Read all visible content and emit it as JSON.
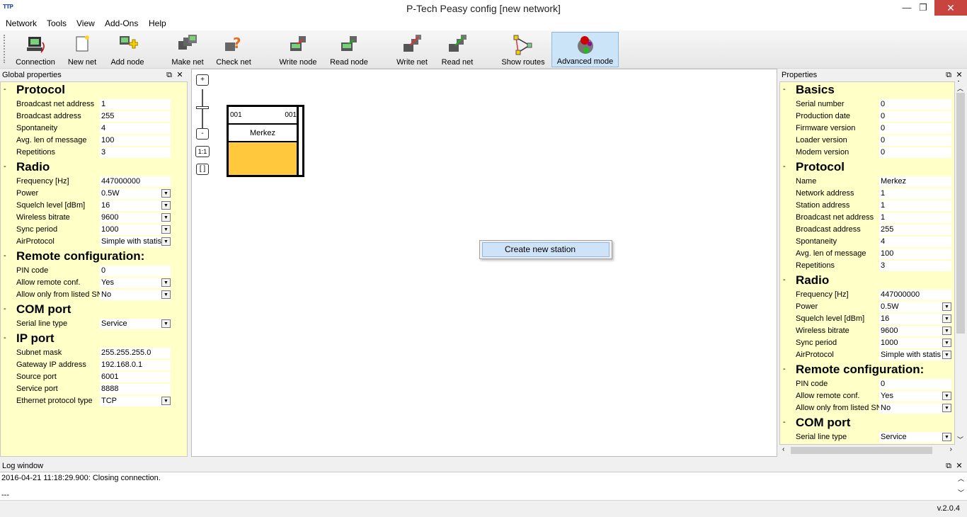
{
  "window": {
    "title": "P-Tech Peasy config [new network]",
    "logo": "TTP",
    "minimize": "—",
    "restore": "❐",
    "close": "✕"
  },
  "menu": [
    "Network",
    "Tools",
    "View",
    "Add-Ons",
    "Help"
  ],
  "toolbar": [
    {
      "label": "Connection",
      "icon": "connection-icon"
    },
    {
      "label": "New net",
      "icon": "new-net-icon"
    },
    {
      "label": "Add node",
      "icon": "add-node-icon"
    },
    {
      "label": "Make net",
      "icon": "make-net-icon"
    },
    {
      "label": "Check net",
      "icon": "check-net-icon"
    },
    {
      "label": "Write node",
      "icon": "write-node-icon"
    },
    {
      "label": "Read node",
      "icon": "read-node-icon"
    },
    {
      "label": "Write net",
      "icon": "write-net-icon"
    },
    {
      "label": "Read net",
      "icon": "read-net-icon"
    },
    {
      "label": "Show routes",
      "icon": "show-routes-icon"
    },
    {
      "label": "Advanced mode",
      "icon": "advanced-mode-icon"
    }
  ],
  "global": {
    "title": "Global properties",
    "sections": [
      {
        "title": "Protocol",
        "rows": [
          [
            "Broadcast net address",
            "1",
            false
          ],
          [
            "Broadcast address",
            "255",
            false
          ],
          [
            "Spontaneity",
            "4",
            false
          ],
          [
            "Avg. len of message",
            "100",
            false
          ],
          [
            "Repetitions",
            "3",
            false
          ]
        ]
      },
      {
        "title": "Radio",
        "rows": [
          [
            "Frequency [Hz]",
            "447000000",
            false
          ],
          [
            "Power",
            "0.5W",
            true
          ],
          [
            "Squelch level [dBm]",
            "16",
            true
          ],
          [
            "Wireless bitrate",
            "9600",
            true
          ],
          [
            "Sync period",
            "1000",
            true
          ],
          [
            "AirProtocol",
            "Simple with statis",
            true
          ]
        ]
      },
      {
        "title": "Remote configuration:",
        "rows": [
          [
            "PIN code",
            "0",
            false
          ],
          [
            "Allow remote conf.",
            "Yes",
            true
          ],
          [
            "Allow only from listed SN",
            "No",
            true
          ]
        ]
      },
      {
        "title": "COM port",
        "rows": [
          [
            "Serial line type",
            "Service",
            true
          ]
        ]
      },
      {
        "title": "IP port",
        "rows": [
          [
            "Subnet mask",
            "255.255.255.0",
            false
          ],
          [
            "Gateway IP address",
            "192.168.0.1",
            false
          ],
          [
            "Source port",
            "6001",
            false
          ],
          [
            "Service port",
            "8888",
            false
          ],
          [
            "Ethernet protocol type",
            "TCP",
            true
          ]
        ]
      }
    ]
  },
  "props": {
    "title": "Properties",
    "sections": [
      {
        "title": "Basics",
        "rows": [
          [
            "Serial number",
            "0",
            false
          ],
          [
            "Production date",
            "0",
            false
          ],
          [
            "Firmware version",
            "0",
            false
          ],
          [
            "Loader version",
            "0",
            false
          ],
          [
            "Modem version",
            "0",
            false
          ]
        ]
      },
      {
        "title": "Protocol",
        "rows": [
          [
            "Name",
            "Merkez",
            false
          ],
          [
            "Network address",
            "1",
            false
          ],
          [
            "Station address",
            "1",
            false
          ],
          [
            "Broadcast net address",
            "1",
            false
          ],
          [
            "Broadcast address",
            "255",
            false
          ],
          [
            "Spontaneity",
            "4",
            false
          ],
          [
            "Avg. len of message",
            "100",
            false
          ],
          [
            "Repetitions",
            "3",
            false
          ]
        ]
      },
      {
        "title": "Radio",
        "rows": [
          [
            "Frequency [Hz]",
            "447000000",
            false
          ],
          [
            "Power",
            "0.5W",
            true
          ],
          [
            "Squelch level [dBm]",
            "16",
            true
          ],
          [
            "Wireless bitrate",
            "9600",
            true
          ],
          [
            "Sync period",
            "1000",
            true
          ],
          [
            "AirProtocol",
            "Simple with statis",
            true
          ]
        ]
      },
      {
        "title": "Remote configuration:",
        "rows": [
          [
            "PIN code",
            "0",
            false
          ],
          [
            "Allow remote conf.",
            "Yes",
            true
          ],
          [
            "Allow only from listed SN",
            "No",
            true
          ]
        ]
      },
      {
        "title": "COM port",
        "rows": [
          [
            "Serial line type",
            "Service",
            true
          ]
        ]
      }
    ]
  },
  "canvas": {
    "zoom_in": "+",
    "zoom_out": "-",
    "zoom_reset": "1:1",
    "zoom_fit": "[ ]",
    "station": {
      "left_code": "001",
      "right_code": "001",
      "name": "Merkez"
    }
  },
  "context_menu": {
    "item": "Create new station"
  },
  "log": {
    "title": "Log window",
    "lines": [
      "2016-04-21 11:18:29.900: Closing connection.",
      "---"
    ]
  },
  "status": {
    "version": "v.2.0.4"
  },
  "panel_buttons": {
    "float": "⧉",
    "close": "✕"
  },
  "colors": {
    "panel_bg": "#ffffc8",
    "station_body": "#ffc83d",
    "active_tool": "#cce4f7",
    "close_button": "#c7443f"
  }
}
